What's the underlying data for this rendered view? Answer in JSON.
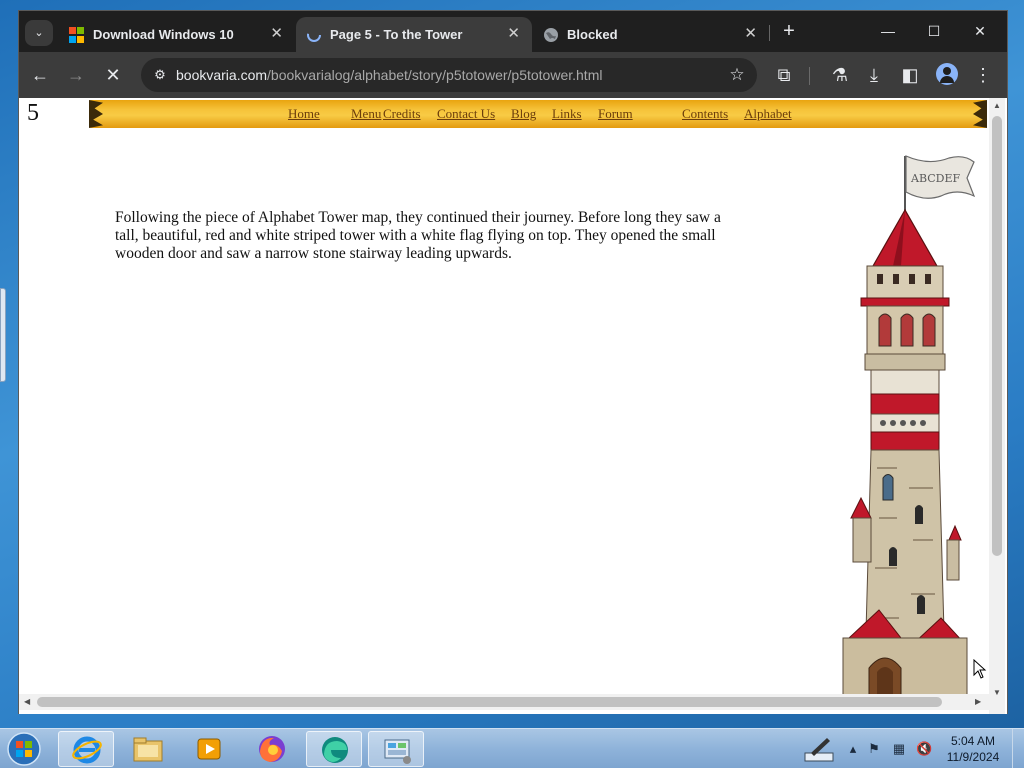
{
  "browser": {
    "tab_search_glyph": "⌄",
    "tabs": [
      {
        "title": "Download Windows 10",
        "active": false,
        "icon": "windows-logo-icon"
      },
      {
        "title": "Page 5 - To the Tower",
        "active": true,
        "icon": "loading-favicon-icon"
      },
      {
        "title": "Blocked",
        "active": false,
        "icon": "globe-icon"
      }
    ],
    "close_glyph": "✕",
    "new_tab_glyph": "+",
    "window_controls": {
      "minimize": "—",
      "maximize": "☐",
      "close": "✕"
    },
    "toolbar": {
      "back_glyph": "←",
      "forward_glyph": "→",
      "stop_glyph": "✕",
      "url_host": "bookvaria.com",
      "url_path": "/bookvarialog/alphabet/story/p5totower/p5totower.html",
      "star_glyph": "☆",
      "extensions_glyph": "⧉",
      "labs_glyph": "⚗",
      "download_glyph": "⤓",
      "sidepanel_glyph": "◧",
      "menu_glyph": "⋮"
    },
    "colors": {
      "chrome_bg": "#1f1f1f",
      "toolbar_bg": "#3c3c3c",
      "omnibox_bg": "#282828",
      "accent": "#8ab4f8"
    }
  },
  "page": {
    "page_number": "5",
    "nav": [
      "Home",
      "Menu",
      "Credits",
      "Contact Us",
      "Blog",
      "Links",
      "Forum",
      "Contents",
      "Alphabet"
    ],
    "story_text": "Following the piece of Alphabet Tower map, they continued their journey. Before long they saw a tall, beautiful, red and white striped tower with a white flag flying on top. They opened the small wooden door and saw a narrow stone stairway leading upwards.",
    "flag_letters": "ABCDEF",
    "colors": {
      "nav_bar": "#f6c33a",
      "nav_link": "#6b3d0b",
      "tower_red": "#c0182a",
      "stone": "#d8cdb4"
    }
  },
  "taskbar": {
    "apps": [
      "internet-explorer-icon",
      "file-explorer-icon",
      "media-player-icon",
      "firefox-icon",
      "edge-icon",
      "control-panel-icon"
    ],
    "tray": {
      "expand_glyph": "▴",
      "flag_glyph": "⚑",
      "network_glyph": "▦",
      "volume_glyph": "🔇"
    },
    "clock": {
      "time": "5:04 AM",
      "date": "11/9/2024"
    }
  }
}
